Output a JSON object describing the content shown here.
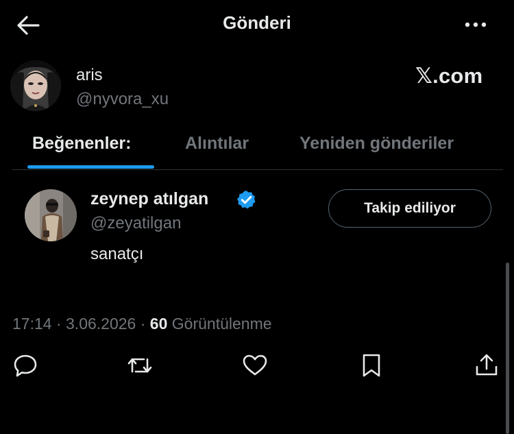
{
  "header": {
    "title": "Gönderi",
    "back_icon": "arrow-left-icon",
    "more_icon": "more-horizontal-icon"
  },
  "author": {
    "name": "aris",
    "handle": "@nyvora_xu",
    "brand": "𝕏.com"
  },
  "tabs": [
    {
      "label": "Beğenenler:",
      "active": true
    },
    {
      "label": "Alıntılar",
      "active": false
    },
    {
      "label": "Yeniden gönderiler",
      "active": false
    }
  ],
  "user": {
    "name": "zeynep atılgan",
    "handle": "@zeyatilgan",
    "bio": "sanatçı",
    "verified_icon": "verified-badge-icon",
    "follow_label": "Takip ediliyor"
  },
  "meta": {
    "time": "17:14",
    "separator": " · ",
    "date": "3.06.2026",
    "views_count": "60",
    "views_label": " Görüntülenme"
  },
  "actions": [
    "reply-icon",
    "repost-icon",
    "like-icon",
    "bookmark-icon",
    "share-icon"
  ],
  "colors": {
    "background": "#000000",
    "text": "#e7e9ea",
    "muted": "#71767b",
    "accent": "#1d9bf0",
    "divider": "#2f3336"
  }
}
